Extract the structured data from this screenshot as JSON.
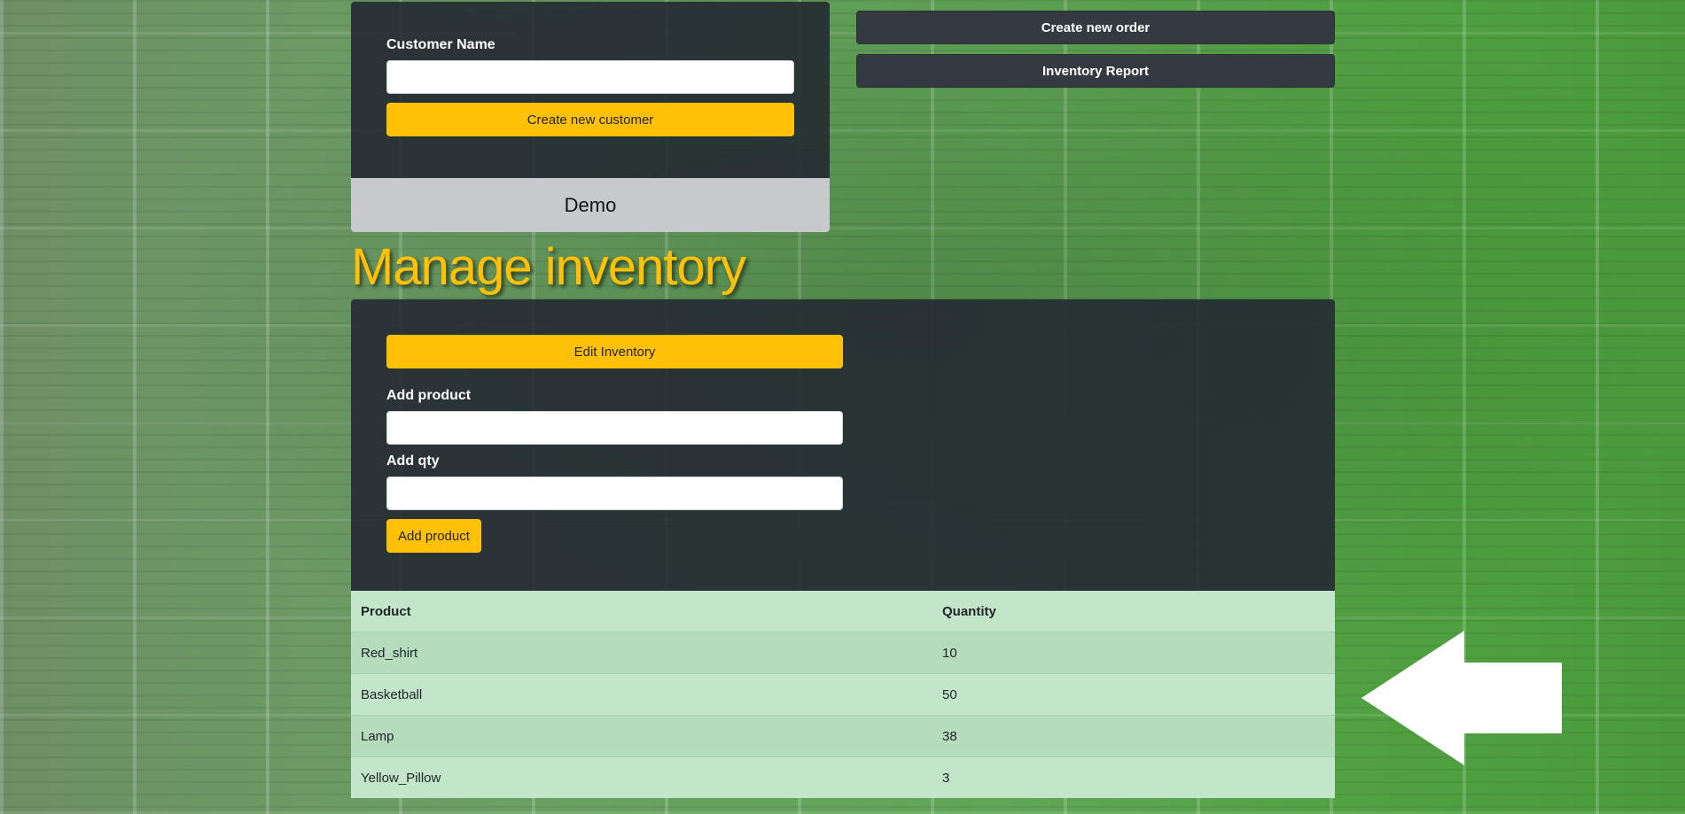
{
  "customer": {
    "name_label": "Customer Name",
    "name_value": "",
    "create_button": "Create new customer",
    "selected": "Demo"
  },
  "actions": {
    "create_order": "Create new order",
    "inventory_report": "Inventory Report"
  },
  "inventory": {
    "heading": "Manage inventory",
    "edit_button": "Edit Inventory",
    "add_product_label": "Add product",
    "add_product_value": "",
    "add_qty_label": "Add qty",
    "add_qty_value": "",
    "add_button": "Add product",
    "table": {
      "columns": [
        "Product",
        "Quantity"
      ],
      "rows": [
        {
          "product": "Red_shirt",
          "quantity": "10"
        },
        {
          "product": "Basketball",
          "quantity": "50"
        },
        {
          "product": "Lamp",
          "quantity": "38"
        },
        {
          "product": "Yellow_Pillow",
          "quantity": "3"
        }
      ]
    }
  },
  "colors": {
    "accent": "#ffc107",
    "panel": "#242932",
    "table_row": "#c3e6cb"
  },
  "icons": {
    "pointer": "left-arrow-icon"
  }
}
